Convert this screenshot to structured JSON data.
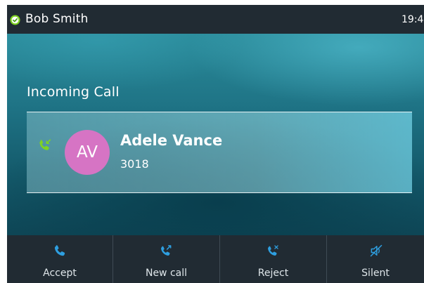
{
  "status_bar": {
    "account_name": "Bob Smith",
    "time": "19:4",
    "status_icon": "registered-check-icon",
    "status_color": "#7ed321"
  },
  "call": {
    "heading": "Incoming Call",
    "caller_initials": "AV",
    "caller_name": "Adele Vance",
    "caller_number": "3018",
    "direction_icon": "incoming-call-icon",
    "avatar_color": "#d674c4",
    "accent_color": "#7ed321"
  },
  "softkeys": [
    {
      "label": "Accept",
      "icon": "phone-icon"
    },
    {
      "label": "New call",
      "icon": "new-call-icon"
    },
    {
      "label": "Reject",
      "icon": "reject-call-icon"
    },
    {
      "label": "Silent",
      "icon": "speaker-mute-icon"
    }
  ],
  "softkey_icon_color": "#2e9fe0"
}
